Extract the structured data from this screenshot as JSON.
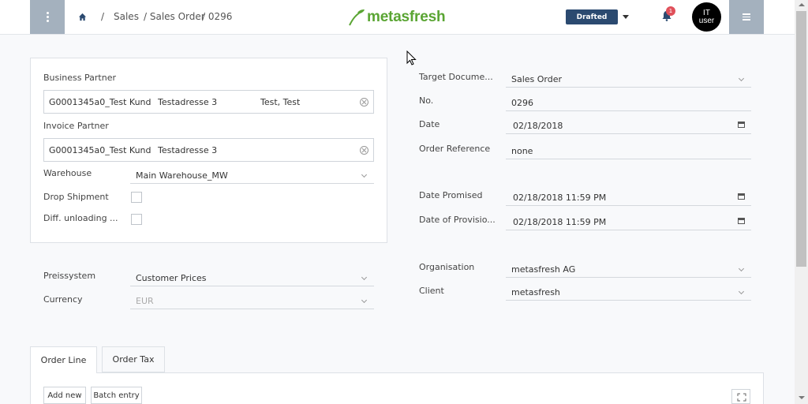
{
  "header": {
    "breadcrumb": [
      "/",
      "Sales",
      "/ Sales Order",
      "/ 0296"
    ],
    "logo_text": "metasfresh",
    "status_label": "Drafted",
    "notification_count": "1",
    "user_line1": "IT",
    "user_line2": "user",
    "brand_color": "#5aa533",
    "nav_color": "#a4b1be"
  },
  "left": {
    "business_partner_label": "Business Partner",
    "bp_name": "G0001345a0_Test Kund",
    "bp_address": "Testadresse 3",
    "bp_contact": "Test, Test",
    "invoice_partner_label": "Invoice Partner",
    "ip_name": "G0001345a0_Test Kund",
    "ip_address": "Testadresse 3",
    "warehouse_label": "Warehouse",
    "warehouse_value": "Main Warehouse_MW",
    "drop_shipment_label": "Drop Shipment",
    "diff_unloading_label": "Diff. unloading ...",
    "price_system_label": "Preissystem",
    "price_system_value": "Customer Prices",
    "currency_label": "Currency",
    "currency_value": "EUR"
  },
  "right": {
    "target_doc_label": "Target Docume...",
    "target_doc_value": "Sales Order",
    "no_label": "No.",
    "no_value": "0296",
    "date_label": "Date",
    "date_value": "02/18/2018",
    "order_ref_label": "Order Reference",
    "order_ref_value": "none",
    "date_promised_label": "Date Promised",
    "date_promised_value": "02/18/2018 11:59 PM",
    "date_provision_label": "Date of Provisio...",
    "date_provision_value": "02/18/2018 11:59 PM",
    "organisation_label": "Organisation",
    "organisation_value": "metasfresh AG",
    "client_label": "Client",
    "client_value": "metasfresh"
  },
  "tabs": [
    {
      "label": "Order Line"
    },
    {
      "label": "Order Tax"
    }
  ],
  "actions": {
    "add_new": "Add new",
    "batch_entry": "Batch entry"
  }
}
